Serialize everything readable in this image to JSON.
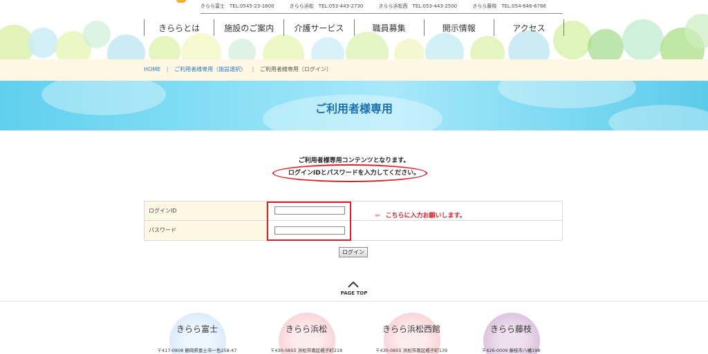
{
  "contact": {
    "items": [
      "きらら富士　TEL:0545-23-1600",
      "きらら浜松　TEL:053-443-2730",
      "きらら浜松西　TEL:053-443-2500",
      "きらら藤枝　TEL:054-646-6766"
    ]
  },
  "nav": {
    "items": [
      "きららとは",
      "施設のご案内",
      "介護サービス",
      "職員募集",
      "開示情報",
      "アクセス"
    ]
  },
  "breadcrumb": {
    "home": "HOME",
    "separator": "|",
    "facility_select": "ご利用者様専用（施設選択）",
    "current": "ご利用者様専用（ログイン）"
  },
  "page": {
    "title": "ご利用者様専用",
    "lead1": "ご利用者様専用コンテンツとなります。",
    "lead2": "ログインIDとパスワードを入力してください。"
  },
  "login_form": {
    "id_label": "ログインID",
    "id_value": "",
    "password_label": "パスワード",
    "password_value": "",
    "hint_arrow": "⇦",
    "hint_text": "こちらに入力お願いします。",
    "submit_label": "ログイン"
  },
  "page_top": {
    "label": "PAGE TOP"
  },
  "facilities": [
    {
      "name": "きらら富士",
      "address": "〒417-0808 静岡県富士市一色258-47",
      "color": "#dcebfb"
    },
    {
      "name": "きらら浜松",
      "address": "〒430-0855 浜松市南区楊子町218",
      "color": "#fbd6d8"
    },
    {
      "name": "きらら浜松西館",
      "address": "〒430-0855 浜松市南区楊子町139",
      "color": "#fbd6d8"
    },
    {
      "name": "きらら藤枝",
      "address": "〒426-0009 藤枝市八幡198",
      "color": "#dcc6dd"
    }
  ],
  "colors": {
    "accent_red": "#d8202a",
    "title_blue": "#1d6fb0",
    "link_blue": "#2a7cc7",
    "cream": "#fdf7e3"
  }
}
